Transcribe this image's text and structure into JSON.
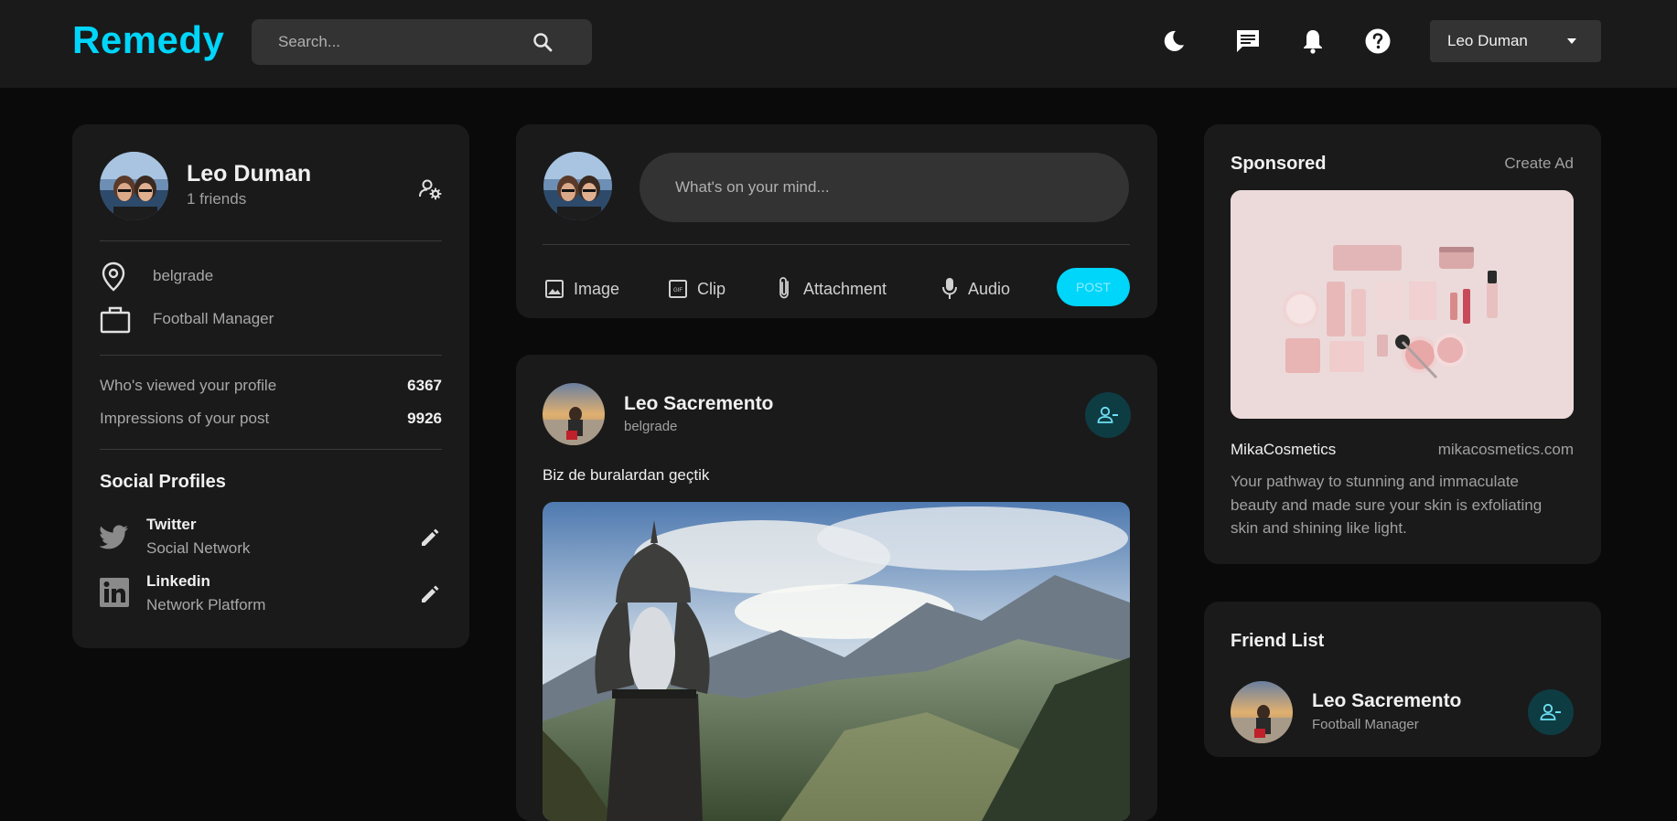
{
  "header": {
    "logo": "Remedy",
    "search_placeholder": "Search...",
    "user_name": "Leo Duman",
    "icons": [
      "moon-icon",
      "chat-icon",
      "bell-icon",
      "help-icon",
      "search-icon",
      "caret-down-icon"
    ]
  },
  "profile": {
    "name": "Leo Duman",
    "friends": "1 friends",
    "location": "belgrade",
    "occupation": "Football Manager",
    "stats": [
      {
        "label": "Who's viewed your profile",
        "value": "6367"
      },
      {
        "label": "Impressions of your post",
        "value": "9926"
      }
    ],
    "social_title": "Social Profiles",
    "social": [
      {
        "name": "Twitter",
        "desc": "Social Network"
      },
      {
        "name": "Linkedin",
        "desc": "Network Platform"
      }
    ]
  },
  "compose": {
    "placeholder": "What's on your mind...",
    "actions": [
      "Image",
      "Clip",
      "Attachment",
      "Audio"
    ],
    "post_label": "POST"
  },
  "post": {
    "author": "Leo Sacremento",
    "location": "belgrade",
    "text": "Biz de buralardan geçtik"
  },
  "sponsored": {
    "title": "Sponsored",
    "create_ad": "Create Ad",
    "brand": "MikaCosmetics",
    "url": "mikacosmetics.com",
    "description_lines": [
      "Your pathway to stunning and immaculate",
      "beauty and made sure your skin is exfoliating",
      "skin and shining like light."
    ]
  },
  "friend_list": {
    "title": "Friend List",
    "friends": [
      {
        "name": "Leo Sacremento",
        "role": "Football Manager"
      }
    ]
  },
  "colors": {
    "accent": "#00d5fa",
    "card": "#1a1a1a",
    "background": "#0a0a0a",
    "field": "#333333"
  }
}
